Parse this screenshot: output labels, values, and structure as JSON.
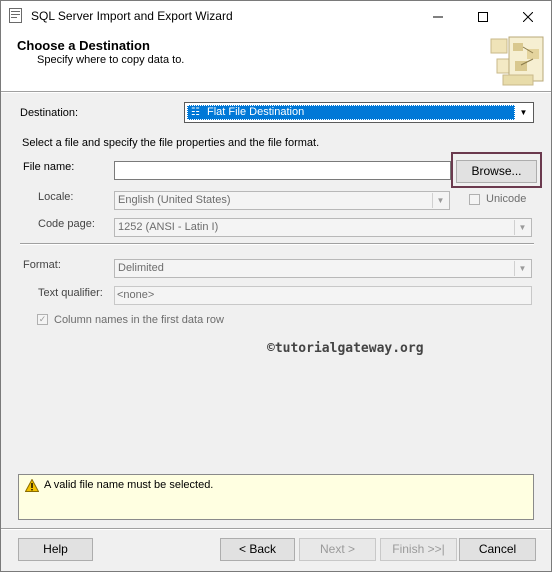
{
  "window": {
    "title": "SQL Server Import and Export Wizard"
  },
  "header": {
    "title": "Choose a Destination",
    "subtitle": "Specify where to copy data to."
  },
  "destination": {
    "label": "Destination:",
    "value": "Flat File Destination"
  },
  "instructions": "Select a file and specify the file properties and the file format.",
  "file_name": {
    "label": "File name:",
    "value": "",
    "browse_label": "Browse..."
  },
  "locale": {
    "label": "Locale:",
    "value": "English (United States)"
  },
  "unicode": {
    "label": "Unicode",
    "checked": false
  },
  "code_page": {
    "label": "Code page:",
    "value": "1252  (ANSI - Latin I)"
  },
  "format": {
    "label": "Format:",
    "value": "Delimited"
  },
  "text_qualifier": {
    "label": "Text qualifier:",
    "value": "<none>"
  },
  "column_names": {
    "label": "Column names in the first data row",
    "checked": true
  },
  "watermark": "©tutorialgateway.org",
  "message": "A valid file name must be selected.",
  "buttons": {
    "help": "Help",
    "back": "< Back",
    "next": "Next >",
    "finish": "Finish >>|",
    "cancel": "Cancel"
  },
  "colors": {
    "selection": "#0078d7",
    "message_bg": "#ffffe1",
    "highlight_border": "#6b3a4e"
  }
}
